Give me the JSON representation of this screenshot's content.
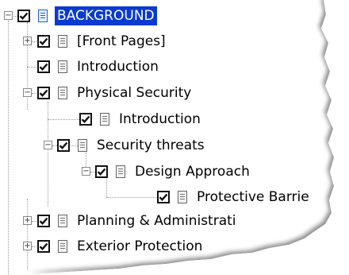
{
  "tree": {
    "root": {
      "label": "BACKGROUND",
      "checked": true,
      "selected": true,
      "icon": "document-blue-icon"
    },
    "items": [
      {
        "label": "[Front Pages]",
        "checked": true,
        "expander": "+",
        "icon": "document-icon"
      },
      {
        "label": "Introduction",
        "checked": true,
        "expander": "",
        "icon": "document-icon"
      },
      {
        "label": "Physical Security",
        "checked": true,
        "expander": "−",
        "icon": "document-icon"
      },
      {
        "label": "Introduction",
        "checked": true,
        "expander": "",
        "icon": "document-icon"
      },
      {
        "label": "Security threats",
        "checked": true,
        "expander": "−",
        "icon": "document-icon"
      },
      {
        "label": "Design Approach",
        "checked": true,
        "expander": "−",
        "icon": "document-icon"
      },
      {
        "label": "Protective Barrie",
        "checked": true,
        "expander": "",
        "icon": "document-icon"
      },
      {
        "label": "Planning & Administrati",
        "checked": true,
        "expander": "+",
        "icon": "document-icon"
      },
      {
        "label": "Exterior Protection",
        "checked": true,
        "expander": "+",
        "icon": "document-icon"
      }
    ]
  },
  "colors": {
    "selection": "#0a3bd1",
    "tree_lines": "#9a9a9a"
  }
}
